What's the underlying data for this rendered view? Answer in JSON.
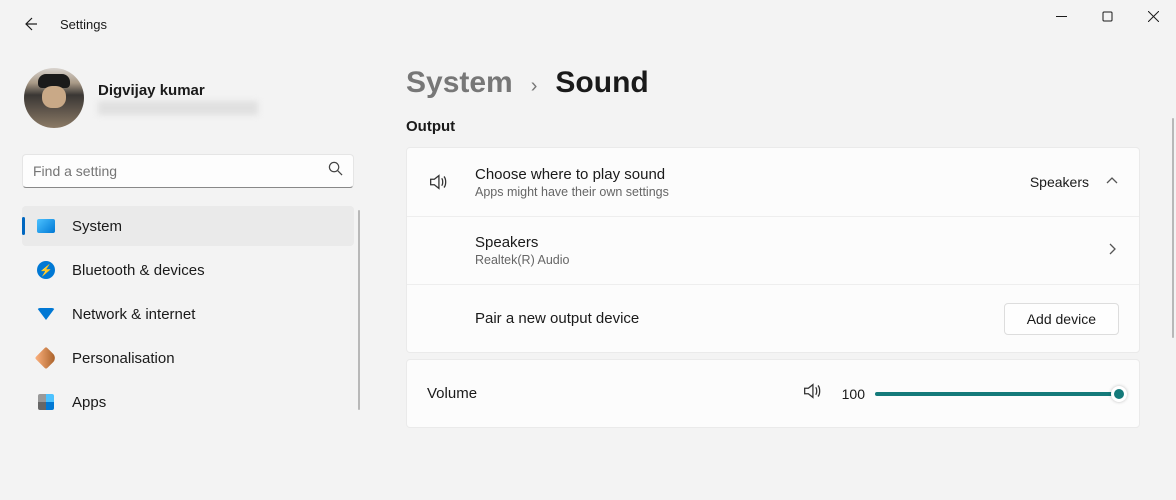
{
  "window": {
    "title": "Settings"
  },
  "profile": {
    "name": "Digvijay kumar",
    "email": " "
  },
  "search": {
    "placeholder": "Find a setting"
  },
  "sidebar": {
    "items": [
      {
        "label": "System"
      },
      {
        "label": "Bluetooth & devices"
      },
      {
        "label": "Network & internet"
      },
      {
        "label": "Personalisation"
      },
      {
        "label": "Apps"
      }
    ]
  },
  "breadcrumb": {
    "parent": "System",
    "current": "Sound"
  },
  "sections": {
    "output_title": "Output",
    "choose": {
      "title": "Choose where to play sound",
      "subtitle": "Apps might have their own settings",
      "value": "Speakers"
    },
    "speakers": {
      "title": "Speakers",
      "subtitle": "Realtek(R) Audio"
    },
    "pair": {
      "title": "Pair a new output device",
      "button": "Add device"
    },
    "volume": {
      "label": "Volume",
      "value": "100"
    }
  }
}
